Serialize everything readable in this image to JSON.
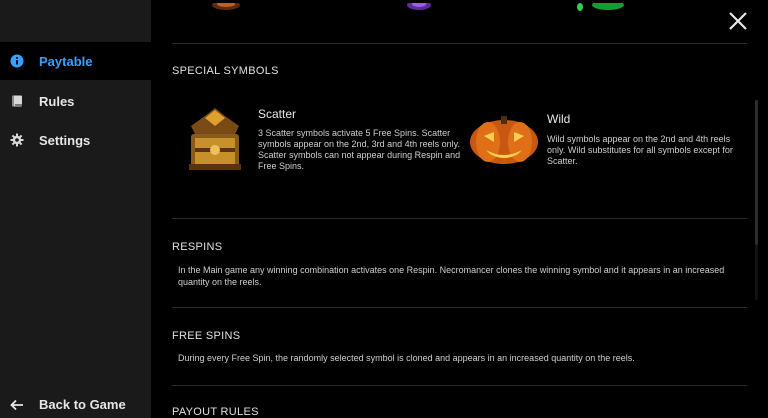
{
  "sidebar": {
    "items": [
      {
        "label": "Paytable",
        "icon": "info-icon",
        "active": true
      },
      {
        "label": "Rules",
        "icon": "book-icon",
        "active": false
      },
      {
        "label": "Settings",
        "icon": "gear-icon",
        "active": false
      }
    ],
    "back_label": "Back to Game"
  },
  "colors": {
    "accent": "#3aa0ff",
    "sidebar_bg": "#1a1a1a",
    "main_bg": "#000000"
  },
  "sections": {
    "special_symbols": {
      "title": "SPECIAL SYMBOLS",
      "scatter": {
        "name": "Scatter",
        "description": "3 Scatter symbols activate 5 Free Spins. Scatter symbols appear on the 2nd, 3rd and 4th reels only. Scatter symbols can not appear during Respin and Free Spins."
      },
      "wild": {
        "name": "Wild",
        "description": "Wild symbols appear on the 2nd and 4th reels only. Wild substitutes for all symbols except for Scatter."
      }
    },
    "respins": {
      "title": "RESPINS",
      "text": "In the Main game any winning combination activates one Respin. Necromancer clones the winning symbol and it appears in an increased quantity on the reels."
    },
    "free_spins": {
      "title": "FREE SPINS",
      "text": "During every Free Spin, the randomly selected symbol is cloned and appears in an increased quantity on the reels."
    },
    "payout_rules": {
      "title": "PAYOUT RULES"
    }
  }
}
